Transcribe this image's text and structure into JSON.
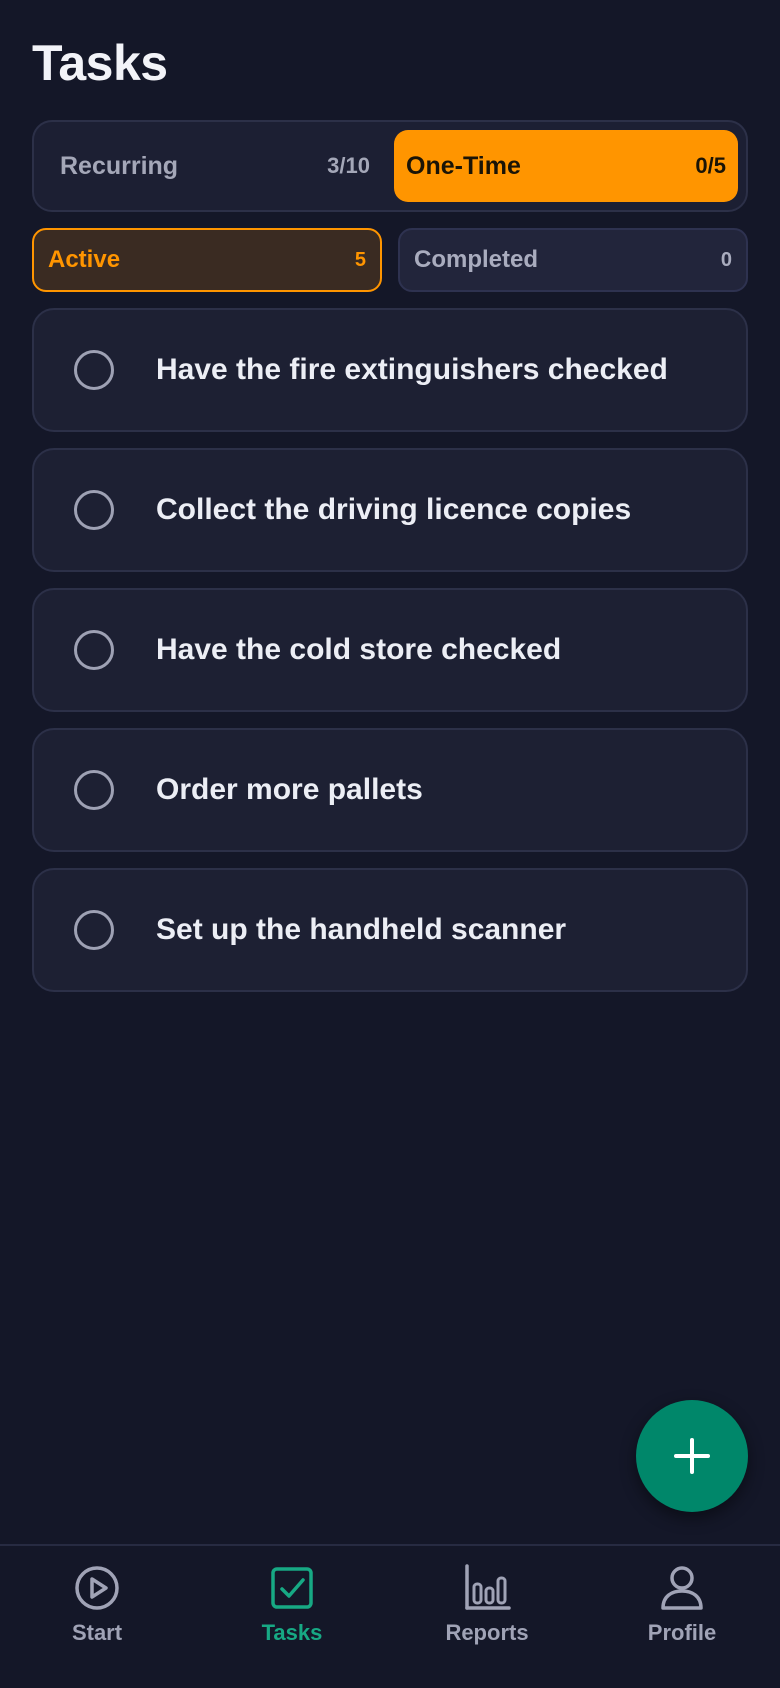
{
  "header": {
    "title": "Tasks"
  },
  "segments": {
    "recurring": {
      "label": "Recurring",
      "count": "3/10"
    },
    "one_time": {
      "label": "One-Time",
      "count": "0/5"
    },
    "selected": "one_time"
  },
  "filters": {
    "active": {
      "label": "Active",
      "count": "5"
    },
    "completed": {
      "label": "Completed",
      "count": "0"
    },
    "selected": "active"
  },
  "tasks": [
    {
      "label": "Have the fire extinguishers checked",
      "done": false
    },
    {
      "label": "Collect the driving licence copies",
      "done": false
    },
    {
      "label": "Have the cold store checked",
      "done": false
    },
    {
      "label": "Order more pallets",
      "done": false
    },
    {
      "label": "Set up the handheld scanner",
      "done": false
    }
  ],
  "fab": {
    "icon": "plus-icon"
  },
  "nav": {
    "items": [
      {
        "label": "Start",
        "icon": "play-circle-icon"
      },
      {
        "label": "Tasks",
        "icon": "checkbox-icon"
      },
      {
        "label": "Reports",
        "icon": "bar-chart-icon"
      },
      {
        "label": "Profile",
        "icon": "person-icon"
      }
    ],
    "active": "Tasks"
  },
  "colors": {
    "background": "#141728",
    "accent_orange": "#ff9500",
    "accent_green": "#00876a",
    "active_nav": "#17a984"
  }
}
